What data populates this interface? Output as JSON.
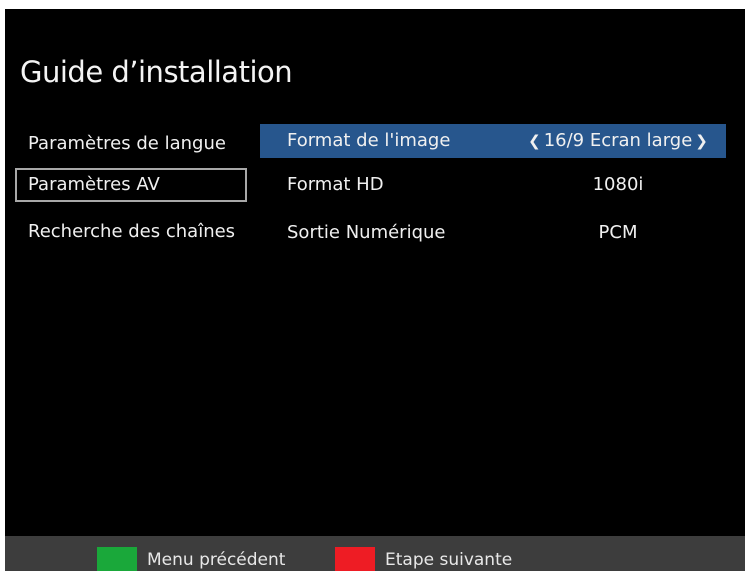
{
  "page": {
    "title": "Guide d’installation"
  },
  "left_menu": {
    "items": [
      {
        "label": "Paramètres de langue"
      },
      {
        "label": "Paramètres AV"
      },
      {
        "label": "Recherche des chaînes"
      }
    ],
    "selected": "Paramètres AV"
  },
  "settings": {
    "rows": [
      {
        "label": "Format de l'image",
        "value": "16/9 Ecran large",
        "arrow_left": "❮",
        "arrow_right": "❯"
      },
      {
        "label": "Format HD",
        "value": "1080i"
      },
      {
        "label": "Sortie Numérique",
        "value": "PCM"
      }
    ],
    "highlighted": "Format de l'image"
  },
  "footer": {
    "green_label": "Menu précédent",
    "red_label": "Etape suivante"
  },
  "colors": {
    "background": "#000000",
    "highlight": "#27568d",
    "footer_bar": "#3d3d3d",
    "green_key": "#1aa83a",
    "red_key": "#ee1c24",
    "selected_border": "#a8a8a8"
  }
}
